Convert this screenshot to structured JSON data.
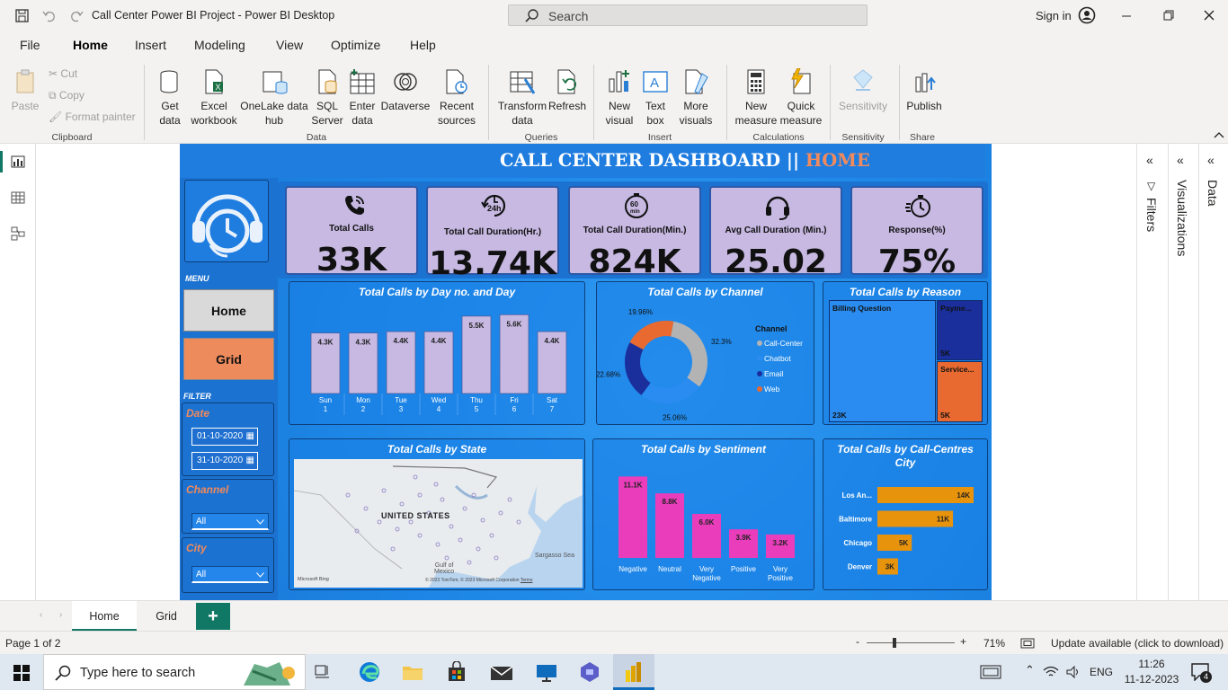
{
  "window": {
    "title": "Call Center Power BI Project - Power BI Desktop",
    "search_placeholder": "Search",
    "signin": "Sign in"
  },
  "menu_tabs": [
    "File",
    "Home",
    "Insert",
    "Modeling",
    "View",
    "Optimize",
    "Help"
  ],
  "ribbon": {
    "clipboard": {
      "paste": "Paste",
      "cut": "Cut",
      "copy": "Copy",
      "format_painter": "Format painter",
      "group": "Clipboard"
    },
    "data": {
      "get_data": "Get\ndata",
      "excel": "Excel\nworkbook",
      "onelake": "OneLake data\nhub",
      "sql": "SQL\nServer",
      "enter": "Enter\ndata",
      "dataverse": "Dataverse",
      "recent": "Recent\nsources",
      "group": "Data"
    },
    "queries": {
      "transform": "Transform\ndata",
      "refresh": "Refresh",
      "group": "Queries"
    },
    "insert": {
      "new_visual": "New\nvisual",
      "text_box": "Text\nbox",
      "more_visuals": "More\nvisuals",
      "group": "Insert"
    },
    "calculations": {
      "new_measure": "New\nmeasure",
      "quick_measure": "Quick\nmeasure",
      "group": "Calculations"
    },
    "sensitivity": {
      "label": "Sensitivity",
      "group": "Sensitivity"
    },
    "share": {
      "publish": "Publish",
      "group": "Share"
    }
  },
  "right_panes": {
    "filters": "Filters",
    "visualizations": "Visualizations",
    "data": "Data"
  },
  "dashboard": {
    "title_main": "CALL CENTER DASHBOARD ||",
    "title_home": "HOME",
    "colors": {
      "accent": "#f28a5c",
      "kpi": "#c7b9e2",
      "pink": "#e93dbb",
      "orange": "#e8930c"
    },
    "menu_label": "MENU",
    "nav": {
      "home": "Home",
      "grid": "Grid"
    },
    "filter_label": "FILTER",
    "filters": {
      "date_label": "Date",
      "date_from": "01-10-2020",
      "date_to": "31-10-2020",
      "channel_label": "Channel",
      "channel_value": "All",
      "city_label": "City",
      "city_value": "All"
    },
    "kpis": [
      {
        "label": "Total Calls",
        "value": "33K",
        "icon": "phone-icon"
      },
      {
        "label": "Total Call Duration(Hr.)",
        "value": "13.74K",
        "icon": "24h-clock-icon"
      },
      {
        "label": "Total Call Duration(Min.)",
        "value": "824K",
        "icon": "60-min-icon"
      },
      {
        "label": "Avg Call Duration (Min.)",
        "value": "25.02",
        "icon": "headset-icon"
      },
      {
        "label": "Response(%)",
        "value": "75%",
        "icon": "stopwatch-icon"
      }
    ],
    "day_chart_title": "Total Calls by Day no. and Day",
    "channel_chart_title": "Total Calls by Channel",
    "reason_chart_title": "Total Calls by Reason",
    "state_chart_title": "Total Calls by State",
    "sentiment_chart_title": "Total Calls by Sentiment",
    "city_chart_title": "Total Calls by Call-Centres City",
    "map": {
      "country_label": "UNITED STATES",
      "gulf_label": "Gulf of\nMexico",
      "sargasso_label": "Sargasso Sea",
      "bing_label": "Microsoft Bing",
      "copyright": "© 2023 TomTom, © 2023 Microsoft Corporation",
      "terms": "Terms"
    },
    "channel_legend_title": "Channel"
  },
  "chart_data": [
    {
      "type": "bar",
      "title": "Total Calls by Day no. and Day",
      "categories": [
        "Sun",
        "Mon",
        "Tue",
        "Wed",
        "Thu",
        "Fri",
        "Sat"
      ],
      "sub_categories": [
        "1",
        "2",
        "3",
        "4",
        "5",
        "6",
        "7"
      ],
      "values": [
        4300,
        4300,
        4400,
        4400,
        5500,
        5600,
        4400
      ],
      "labels": [
        "4.3K",
        "4.3K",
        "4.4K",
        "4.4K",
        "5.5K",
        "5.6K",
        "4.4K"
      ],
      "ylim": [
        0,
        6000
      ]
    },
    {
      "type": "pie",
      "title": "Total Calls by Channel",
      "categories": [
        "Call-Center",
        "Chatbot",
        "Email",
        "Web"
      ],
      "values": [
        32.3,
        25.06,
        22.68,
        19.96
      ],
      "labels": [
        "32.3%",
        "25.06%",
        "22.68%",
        "19.96%"
      ],
      "colors": [
        "#b3b3b3",
        "#2a8cf0",
        "#1a2e9c",
        "#e86a30"
      ]
    },
    {
      "type": "heatmap",
      "title": "Total Calls by Reason",
      "categories": [
        "Billing Question",
        "Payme...",
        "Service..."
      ],
      "values": [
        23000,
        5000,
        5000
      ],
      "labels": [
        "23K",
        "5K",
        "5K"
      ],
      "colors": [
        "#2a8cf0",
        "#1a2e9c",
        "#e86a30"
      ]
    },
    {
      "type": "bar",
      "title": "Total Calls by Sentiment",
      "categories": [
        "Negative",
        "Neutral",
        "Very Negative",
        "Positive",
        "Very Positive"
      ],
      "values": [
        11100,
        8800,
        6000,
        3900,
        3200
      ],
      "labels": [
        "11.1K",
        "8.8K",
        "6.0K",
        "3.9K",
        "3.2K"
      ],
      "ylim": [
        0,
        12000
      ]
    },
    {
      "type": "bar",
      "title": "Total Calls by Call-Centres City",
      "orientation": "horizontal",
      "categories": [
        "Los An...",
        "Baltimore",
        "Chicago",
        "Denver"
      ],
      "values": [
        14000,
        11000,
        5000,
        3000
      ],
      "labels": [
        "14K",
        "11K",
        "5K",
        "3K"
      ],
      "xlim": [
        0,
        14000
      ]
    }
  ],
  "tabs": {
    "home": "Home",
    "grid": "Grid",
    "add": "+"
  },
  "status": {
    "page": "Page 1 of 2",
    "zoom": "71%",
    "update": "Update available (click to download)"
  },
  "taskbar": {
    "search": "Type here to search",
    "lang": "ENG",
    "time": "11:26",
    "date": "11-12-2023",
    "notif": "4"
  }
}
